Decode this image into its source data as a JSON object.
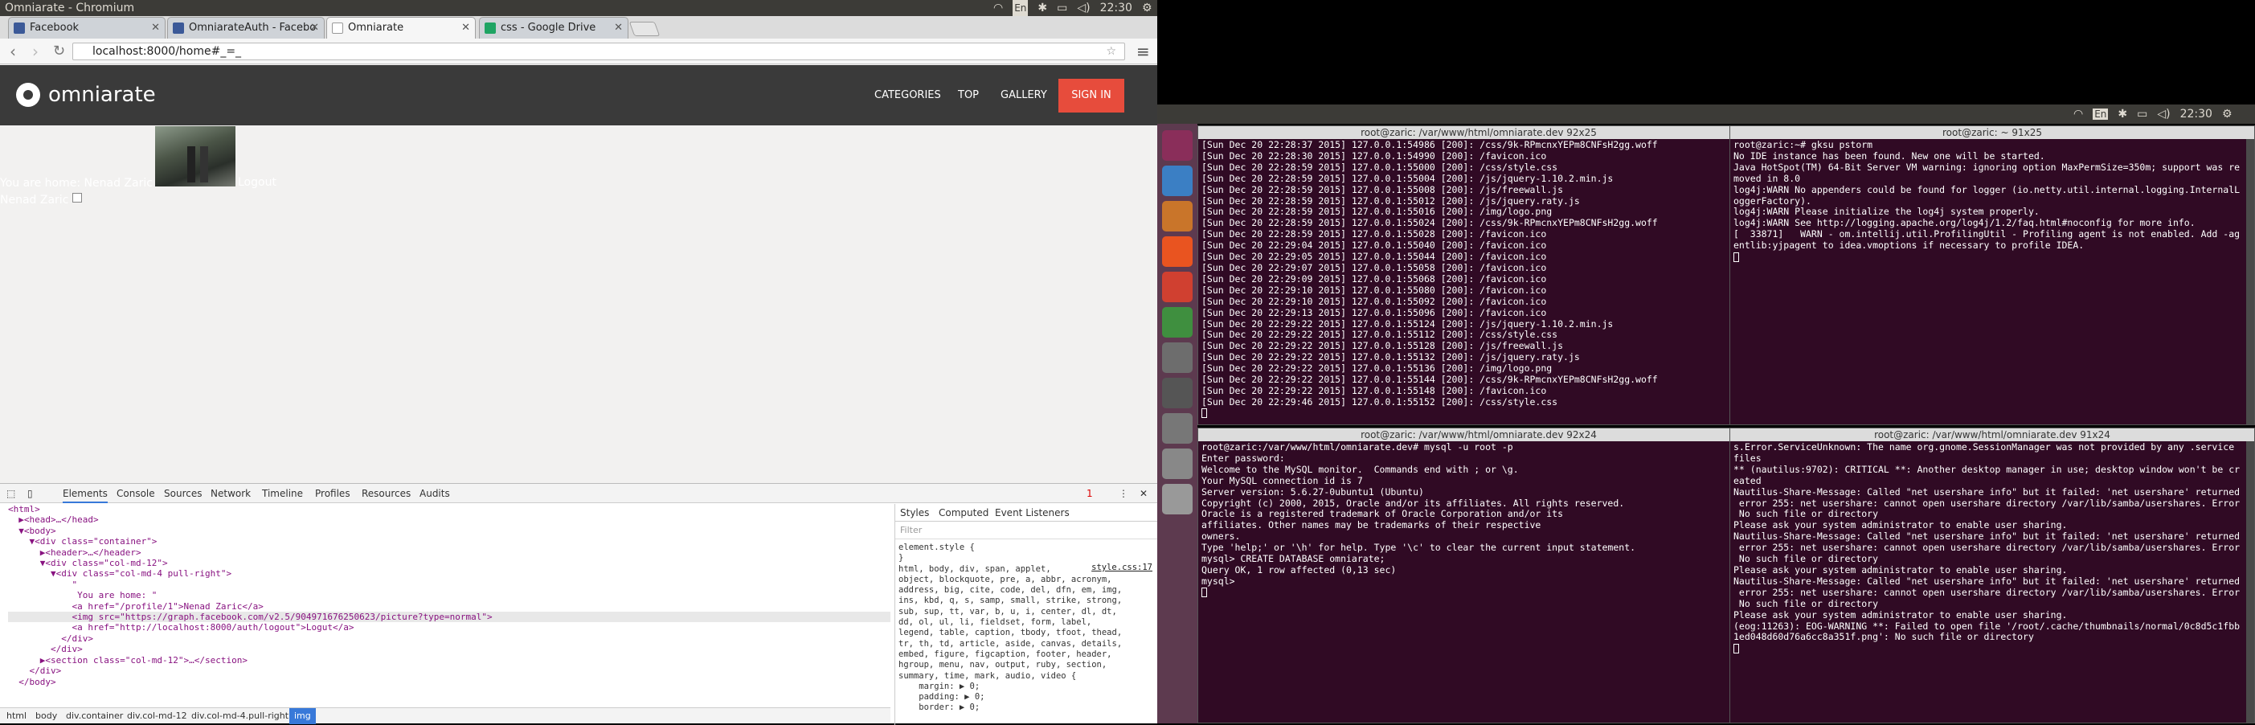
{
  "window": {
    "title": "Omniarate - Chromium",
    "clock": "22:30",
    "kbd": "En"
  },
  "tabs": [
    {
      "label": "Facebook",
      "favicon_color": "#3b5998"
    },
    {
      "label": "OmniarateAuth - Facebo",
      "favicon_color": "#3b5998"
    },
    {
      "label": "Omniarate",
      "favicon_color": "#ffffff"
    },
    {
      "label": "css - Google Drive",
      "favicon_color": "#1fa463"
    }
  ],
  "address": "localhost:8000/home#_=_",
  "site": {
    "brand": "omniarate",
    "nav": [
      "CATEGORIES",
      "TOP",
      "GALLERY"
    ],
    "signin": "SIGN IN",
    "accent": "#e74c3c",
    "text1": "You are home: Nenad Zaric",
    "logout": "Logout",
    "text2": "Nenad Zaric"
  },
  "devtools": {
    "tabs": [
      "Elements",
      "Console",
      "Sources",
      "Network",
      "Timeline",
      "Profiles",
      "Resources",
      "Audits"
    ],
    "error_count": "1",
    "dom": [
      "<html>",
      "  ▶<head>…</head>",
      "  ▼<body>",
      "    ▼<div class=\"container\">",
      "      ▶<header>…</header>",
      "      ▼<div class=\"col-md-12\">",
      "        ▼<div class=\"col-md-4 pull-right\">",
      "            \"",
      "",
      "             You are home: \"",
      "            <a href=\"/profile/1\">Nenad Zaric</a>",
      "            <img src=\"https://graph.facebook.com/v2.5/904971676250623/picture?type=normal\">",
      "            <a href=\"http://localhost:8000/auth/logout\">Logut</a>",
      "          </div>",
      "        </div>",
      "      ▶<section class=\"col-md-12\">…</section>",
      "    </div>",
      "  </body>"
    ],
    "styles_tabs": [
      "Styles",
      "Computed",
      "Event Listeners"
    ],
    "filter": "Filter",
    "styles": [
      "element.style {",
      "}",
      "",
      "html, body, div, span, applet,",
      "object, blockquote, pre, a, abbr, acronym,",
      "address, big, cite, code, del, dfn, em, img,",
      "ins, kbd, q, s, samp, small, strike, strong,",
      "sub, sup, tt, var, b, u, i, center, dl, dt,",
      "dd, ol, ul, li, fieldset, form, label,",
      "legend, table, caption, tbody, tfoot, thead,",
      "tr, th, td, article, aside, canvas, details,",
      "embed, figure, figcaption, footer, header,",
      "hgroup, menu, nav, output, ruby, section,",
      "summary, time, mark, audio, video {",
      "    margin: ▶ 0;",
      "    padding: ▶ 0;",
      "    border: ▶ 0;"
    ],
    "styles_link": "style.css:17",
    "crumbs": [
      "html",
      "body",
      "div.container",
      "div.col-md-12",
      "div.col-md-4.pull-right",
      "img"
    ]
  },
  "terminals": [
    {
      "title": "root@zaric: /var/www/html/omniarate.dev 92x25",
      "lines": [
        "[Sun Dec 20 22:28:37 2015] 127.0.0.1:54986 [200]: /css/9k-RPmcnxYEPm8CNFsH2gg.woff",
        "[Sun Dec 20 22:28:30 2015] 127.0.0.1:54990 [200]: /favicon.ico",
        "[Sun Dec 20 22:28:59 2015] 127.0.0.1:55000 [200]: /css/style.css",
        "[Sun Dec 20 22:28:59 2015] 127.0.0.1:55004 [200]: /js/jquery-1.10.2.min.js",
        "[Sun Dec 20 22:28:59 2015] 127.0.0.1:55008 [200]: /js/freewall.js",
        "[Sun Dec 20 22:28:59 2015] 127.0.0.1:55012 [200]: /js/jquery.raty.js",
        "[Sun Dec 20 22:28:59 2015] 127.0.0.1:55016 [200]: /img/logo.png",
        "[Sun Dec 20 22:28:59 2015] 127.0.0.1:55024 [200]: /css/9k-RPmcnxYEPm8CNFsH2gg.woff",
        "[Sun Dec 20 22:28:59 2015] 127.0.0.1:55028 [200]: /favicon.ico",
        "[Sun Dec 20 22:29:04 2015] 127.0.0.1:55040 [200]: /favicon.ico",
        "[Sun Dec 20 22:29:05 2015] 127.0.0.1:55044 [200]: /favicon.ico",
        "[Sun Dec 20 22:29:07 2015] 127.0.0.1:55058 [200]: /favicon.ico",
        "[Sun Dec 20 22:29:09 2015] 127.0.0.1:55068 [200]: /favicon.ico",
        "[Sun Dec 20 22:29:10 2015] 127.0.0.1:55080 [200]: /favicon.ico",
        "[Sun Dec 20 22:29:10 2015] 127.0.0.1:55092 [200]: /favicon.ico",
        "[Sun Dec 20 22:29:13 2015] 127.0.0.1:55096 [200]: /favicon.ico",
        "[Sun Dec 20 22:29:22 2015] 127.0.0.1:55124 [200]: /js/jquery-1.10.2.min.js",
        "[Sun Dec 20 22:29:22 2015] 127.0.0.1:55112 [200]: /css/style.css",
        "[Sun Dec 20 22:29:22 2015] 127.0.0.1:55128 [200]: /js/freewall.js",
        "[Sun Dec 20 22:29:22 2015] 127.0.0.1:55132 [200]: /js/jquery.raty.js",
        "[Sun Dec 20 22:29:22 2015] 127.0.0.1:55136 [200]: /img/logo.png",
        "[Sun Dec 20 22:29:22 2015] 127.0.0.1:55144 [200]: /css/9k-RPmcnxYEPm8CNFsH2gg.woff",
        "[Sun Dec 20 22:29:22 2015] 127.0.0.1:55148 [200]: /favicon.ico",
        "[Sun Dec 20 22:29:46 2015] 127.0.0.1:55152 [200]: /css/style.css"
      ]
    },
    {
      "title": "root@zaric: ~ 91x25",
      "lines": [
        "root@zaric:~# gksu pstorm",
        "No IDE instance has been found. New one will be started.",
        "Java HotSpot(TM) 64-Bit Server VM warning: ignoring option MaxPermSize=350m; support was re",
        "moved in 8.0",
        "log4j:WARN No appenders could be found for logger (io.netty.util.internal.logging.InternalL",
        "oggerFactory).",
        "log4j:WARN Please initialize the log4j system properly.",
        "log4j:WARN See http://logging.apache.org/log4j/1.2/faq.html#noconfig for more info.",
        "[  33871]   WARN - om.intellij.util.ProfilingUtil - Profiling agent is not enabled. Add -ag",
        "entlib:yjpagent to idea.vmoptions if necessary to profile IDEA."
      ]
    },
    {
      "title": "root@zaric: /var/www/html/omniarate.dev 92x24",
      "lines": [
        "root@zaric:/var/www/html/omniarate.dev# mysql -u root -p",
        "Enter password:",
        "Welcome to the MySQL monitor.  Commands end with ; or \\g.",
        "Your MySQL connection id is 7",
        "Server version: 5.6.27-0ubuntu1 (Ubuntu)",
        "",
        "Copyright (c) 2000, 2015, Oracle and/or its affiliates. All rights reserved.",
        "",
        "Oracle is a registered trademark of Oracle Corporation and/or its",
        "affiliates. Other names may be trademarks of their respective",
        "owners.",
        "",
        "Type 'help;' or '\\h' for help. Type '\\c' to clear the current input statement.",
        "",
        "mysql> CREATE DATABASE omniarate;",
        "Query OK, 1 row affected (0,13 sec)",
        "",
        "mysql> "
      ]
    },
    {
      "title": "root@zaric: /var/www/html/omniarate.dev 91x24",
      "lines": [
        "s.Error.ServiceUnknown: The name org.gnome.SessionManager was not provided by any .service",
        "files",
        "",
        "** (nautilus:9702): CRITICAL **: Another desktop manager in use; desktop window won't be cr",
        "eated",
        "Nautilus-Share-Message: Called \"net usershare info\" but it failed: 'net usershare' returned",
        " error 255: net usershare: cannot open usershare directory /var/lib/samba/usershares. Error",
        " No such file or directory",
        "Please ask your system administrator to enable user sharing.",
        "",
        "Nautilus-Share-Message: Called \"net usershare info\" but it failed: 'net usershare' returned",
        " error 255: net usershare: cannot open usershare directory /var/lib/samba/usershares. Error",
        " No such file or directory",
        "Please ask your system administrator to enable user sharing.",
        "",
        "Nautilus-Share-Message: Called \"net usershare info\" but it failed: 'net usershare' returned",
        " error 255: net usershare: cannot open usershare directory /var/lib/samba/usershares. Error",
        " No such file or directory",
        "Please ask your system administrator to enable user sharing.",
        "",
        "",
        "(eog:11263): EOG-WARNING **: Failed to open file '/root/.cache/thumbnails/normal/0c8d5c1fbb",
        "1ed048d60d76a6cc8a351f.png': No such file or directory"
      ]
    }
  ],
  "launcher_icons": [
    "dash",
    "chromium",
    "files",
    "software",
    "impress",
    "calc",
    "browser",
    "settings",
    "drive",
    "disk",
    "text-editor"
  ]
}
